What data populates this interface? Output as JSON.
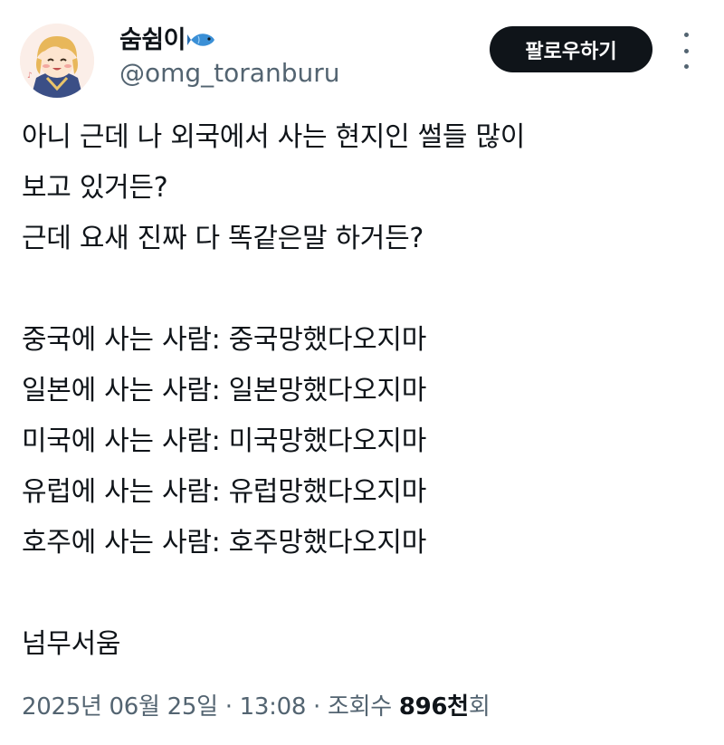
{
  "user": {
    "display_name": "숨쉼이",
    "name_emoji_icon": "fish-icon",
    "handle": "@omg_toranburu",
    "avatar_icon": "anime-character-avatar"
  },
  "actions": {
    "follow_label": "팔로우하기",
    "more_icon": "more-vertical-icon"
  },
  "tweet": {
    "lines": [
      "아니 근데 나 외국에서 사는 현지인 썰들 많이",
      "보고 있거든?",
      "근데 요새 진짜 다 똑같은말 하거든?",
      "",
      "중국에 사는 사람: 중국망했다오지마",
      "일본에 사는 사람: 일본망했다오지마",
      "미국에 사는 사람: 미국망했다오지마",
      "유럽에 사는 사람: 유럽망했다오지마",
      "호주에 사는 사람: 호주망했다오지마",
      "",
      "넘무서움"
    ]
  },
  "meta": {
    "date": "2025년 06월 25일",
    "separator": " · ",
    "time": "13:08",
    "views_label": "조회수 ",
    "views_number": "896천",
    "views_suffix": "회"
  },
  "colors": {
    "text": "#0f1419",
    "secondary": "#536471",
    "follow_bg": "#0f1419",
    "follow_text": "#ffffff",
    "fish": "#3a8fd6"
  }
}
